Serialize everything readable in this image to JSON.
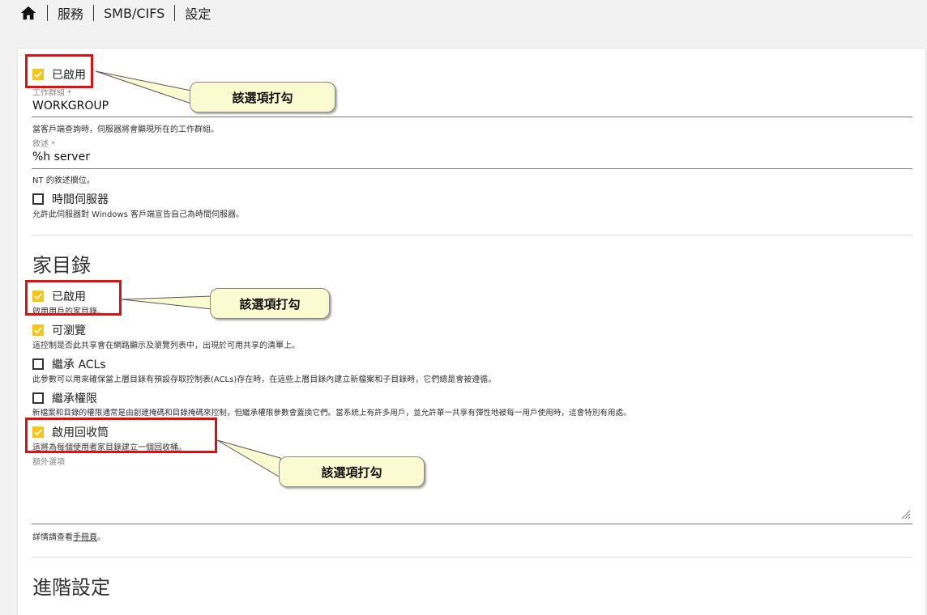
{
  "breadcrumb": {
    "home_icon": "home-icon",
    "items": [
      "服務",
      "SMB/CIFS",
      "設定"
    ]
  },
  "form": {
    "enabled_label": "已啟用",
    "workgroup": {
      "label": "工作群組 *",
      "value": "WORKGROUP",
      "hint": "當客戶端查詢時，伺服器將會顯現所在的工作群組。"
    },
    "description": {
      "label": "敘述 *",
      "value": "%h server",
      "hint": "NT 的敘述欄位。"
    },
    "time_server": {
      "label": "時間伺服器",
      "hint": "允許此伺服器對 Windows 客戶端宣告自己為時間伺服器。",
      "checked": false
    }
  },
  "home_dirs": {
    "title": "家目錄",
    "enabled": {
      "label": "已啟用",
      "hint": "啟用用戶的家目錄。",
      "checked": true
    },
    "browseable": {
      "label": "可瀏覽",
      "hint": "這控制是否此共享會在網路顯示及瀏覽列表中，出現於可用共享的清單上。",
      "checked": true
    },
    "inherit_acls": {
      "label": "繼承 ACLs",
      "hint": "此參數可以用來確保當上層目錄有預設存取控制表(ACLs)存在時，在這些上層目錄內建立新檔案和子目錄時，它們總是會被遵循。",
      "checked": false
    },
    "inherit_perms": {
      "label": "繼承權限",
      "hint": "新檔案和目錄的權限通常是由創建掩碼和目錄掩碼來控制，但繼承權限參數會蓋換它們。當系統上有許多用戶，並允許單一共享有彈性地被每一用戶使用時，這會特別有用處。",
      "checked": false
    },
    "recycle_bin": {
      "label": "啟用回收筒",
      "hint": "這將為每個使用者家目錄建立一個回收桶。",
      "checked": true
    },
    "extra_options": {
      "label": "額外選項",
      "value": ""
    },
    "manual_hint_prefix": "詳情請查看",
    "manual_link": "手冊頁",
    "manual_hint_suffix": "。"
  },
  "advanced": {
    "title": "進階設定"
  },
  "callouts": {
    "text": "該選項打勾"
  },
  "colors": {
    "accent": "#f5c518",
    "highlight": "#e01010",
    "callout_bg": "#fbfbd1"
  }
}
